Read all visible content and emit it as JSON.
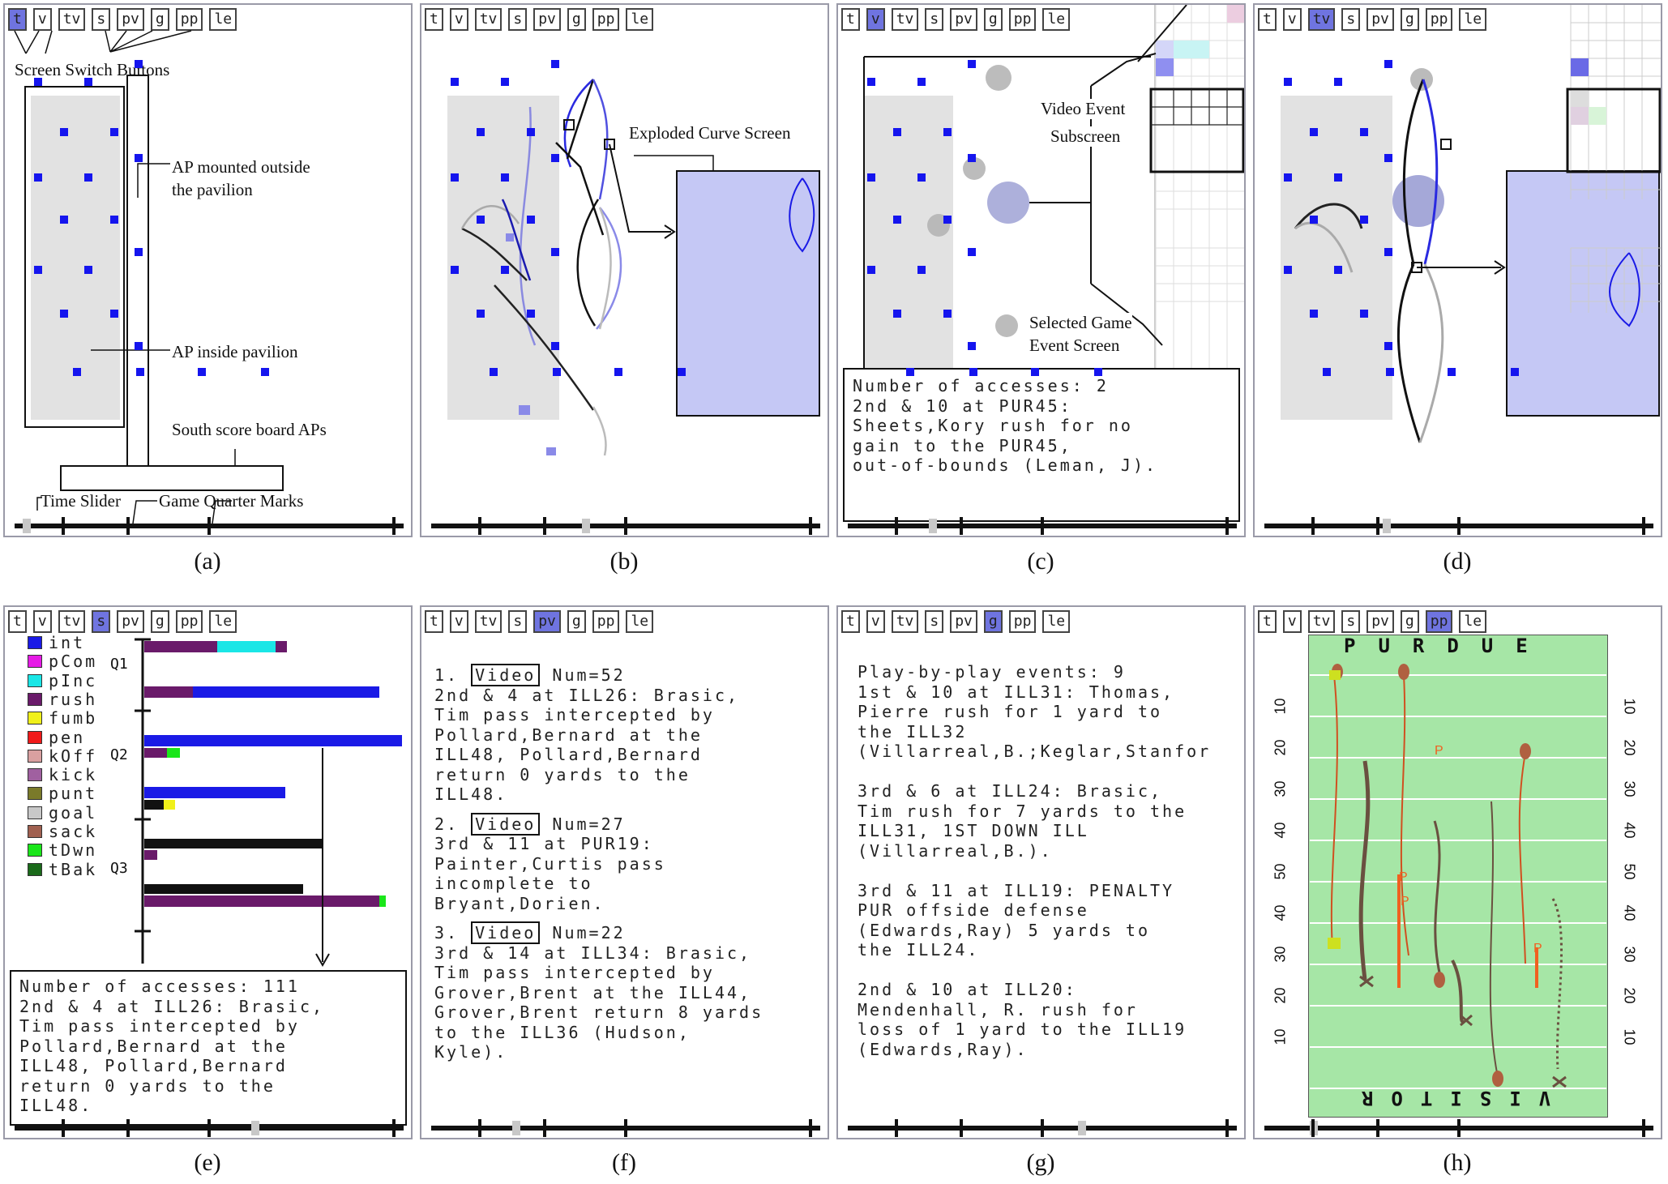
{
  "toolbar": {
    "buttons": [
      "t",
      "v",
      "tv",
      "s",
      "pv",
      "g",
      "pp",
      "le"
    ]
  },
  "captions": [
    "(a)",
    "(b)",
    "(c)",
    "(d)",
    "(e)",
    "(f)",
    "(g)",
    "(h)"
  ],
  "panel_a": {
    "annotations": {
      "screen_switch": "Screen Switch Buttons",
      "ap_outside_1": "AP mounted outside",
      "ap_outside_2": "the pavilion",
      "ap_inside": "AP inside pavilion",
      "south_board": "South score board APs",
      "time_slider": "Time Slider",
      "quarter_marks": "Game Quarter Marks"
    }
  },
  "panel_b": {
    "annotations": {
      "exploded": "Exploded Curve Screen"
    }
  },
  "panel_c": {
    "annotations": {
      "video_event_1": "Video Event",
      "video_event_2": "Subscreen",
      "selected_game_1": "Selected Game",
      "selected_game_2": "Event Screen"
    },
    "event_text": "Number of accesses: 2\n2nd & 10 at PUR45:\nSheets,Kory rush for no\ngain to the PUR45,\nout-of-bounds (Leman, J)."
  },
  "panel_e": {
    "legend": [
      {
        "label": "int",
        "color": "#1a1ae6"
      },
      {
        "label": "pCom",
        "color": "#e61ae6"
      },
      {
        "label": "pInc",
        "color": "#1ae6e6"
      },
      {
        "label": "rush",
        "color": "#6a1a6a"
      },
      {
        "label": "fumb",
        "color": "#f0f01a"
      },
      {
        "label": "pen",
        "color": "#f01a1a"
      },
      {
        "label": "kOff",
        "color": "#d9a0a0"
      },
      {
        "label": "kick",
        "color": "#a060a0"
      },
      {
        "label": "punt",
        "color": "#7a7a2a"
      },
      {
        "label": "goal",
        "color": "#c8c8c8"
      },
      {
        "label": "sack",
        "color": "#a06050"
      },
      {
        "label": "tDwn",
        "color": "#1ae61a"
      },
      {
        "label": "tBak",
        "color": "#1a6a1a"
      }
    ],
    "quarters": [
      "Q1",
      "Q2",
      "Q3"
    ],
    "event_text": "Number of accesses: 111\n2nd & 4 at ILL26: Brasic,\nTim pass intercepted by\nPollard,Bernard at the\nILL48, Pollard,Bernard\nreturn 0 yards to the\nILL48."
  },
  "panel_f": {
    "video_label": "Video",
    "items": [
      {
        "index": "1.",
        "num": "Num=52",
        "text": "2nd & 4 at ILL26: Brasic,\nTim pass intercepted by\nPollard,Bernard at the\nILL48, Pollard,Bernard\nreturn 0 yards to the\nILL48."
      },
      {
        "index": "2.",
        "num": "Num=27",
        "text": "3rd & 11 at PUR19:\nPainter,Curtis pass\nincomplete to\nBryant,Dorien."
      },
      {
        "index": "3.",
        "num": "Num=22",
        "text": "3rd & 14 at ILL34: Brasic,\nTim pass intercepted by\nGrover,Brent at the ILL44,\nGrover,Brent return 8 yards\nto the ILL36 (Hudson,\nKyle)."
      }
    ]
  },
  "panel_g": {
    "text": "Play-by-play events: 9\n1st & 10 at ILL31: Thomas,\nPierre rush for 1 yard to\nthe ILL32\n(Villarreal,B.;Keglar,Stanfor\n\n3rd & 6 at ILL24: Brasic,\nTim rush for 7 yards to the\nILL31, 1ST DOWN ILL\n(Villarreal,B.).\n\n3rd & 11 at ILL19: PENALTY\nPUR offside defense\n(Edwards,Ray) 5 yards to\nthe ILL24.\n\n2nd & 10 at ILL20:\nMendenhall, R. rush for\nloss of 1 yard to the ILL19\n(Edwards,Ray)."
  },
  "panel_h": {
    "top_team": "PURDUE",
    "bottom_team": "VISITOR",
    "yard_left": [
      "10",
      "20",
      "30",
      "40",
      "50",
      "40",
      "30",
      "20",
      "10"
    ],
    "yard_right": [
      "10",
      "20",
      "30",
      "40",
      "50",
      "40",
      "30",
      "20",
      "10"
    ],
    "marker": "P"
  }
}
